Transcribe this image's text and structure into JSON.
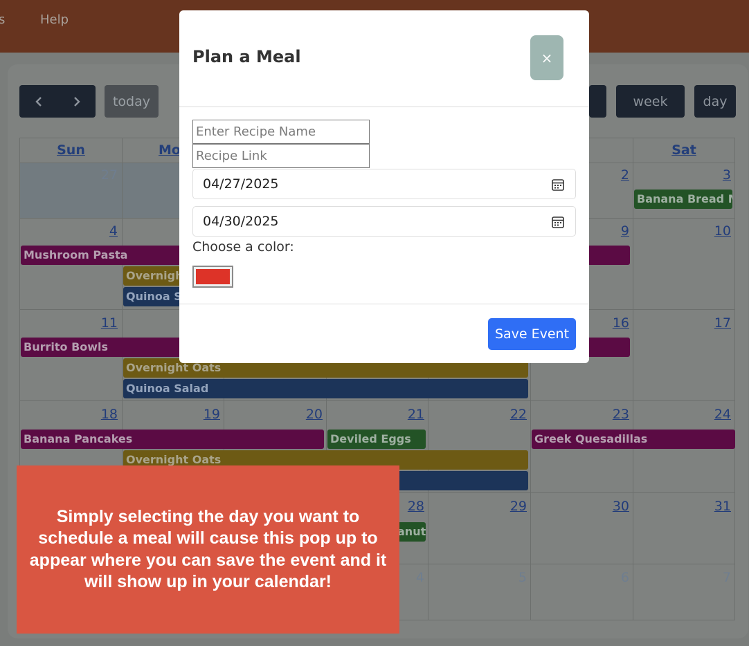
{
  "nav": {
    "left_fragment": "s",
    "help": "Help"
  },
  "toolbar": {
    "prev_icon": "chevron-left-icon",
    "next_icon": "chevron-right-icon",
    "today": "today",
    "week": "week",
    "day": "day"
  },
  "calendar": {
    "weekdays": [
      "Sun",
      "Mo",
      "Sat"
    ],
    "days": {
      "d27": "27",
      "d2": "2",
      "d3": "3",
      "d4": "4",
      "d9": "9",
      "d10": "10",
      "d11": "11",
      "d16": "16",
      "d17": "17",
      "d18": "18",
      "d19": "19",
      "d20": "20",
      "d21": "21",
      "d22": "22",
      "d23": "23",
      "d24": "24",
      "d28": "28",
      "d29": "29",
      "d30": "30",
      "d31": "31",
      "n4": "4",
      "n5": "5",
      "n6": "6",
      "n7": "7"
    },
    "events": {
      "banana_bread": "Banana Bread Muffins",
      "mushroom_pasta": "Mushroom Pasta",
      "overnight_oats": "Overnight",
      "quinoa_salad": "Quinoa Sa",
      "burrito_bowls": "Burrito Bowls",
      "overnight_oats_2": "Overnight Oats",
      "quinoa_salad_2": "Quinoa Salad",
      "banana_pancakes": "Banana Pancakes",
      "deviled_eggs": "Deviled Eggs",
      "greek_quesadillas": "Greek Quesadillas",
      "overnight_oats_3": "Overnight Oats",
      "peanut": "anut"
    }
  },
  "modal": {
    "title": "Plan a Meal",
    "close": "×",
    "recipe_name_placeholder": "Enter Recipe Name",
    "recipe_link_placeholder": "Recipe Link",
    "start_date": "04/27/2025",
    "end_date": "04/30/2025",
    "color_label": "Choose a color:",
    "color_value": "#dd3328",
    "save": "Save Event"
  },
  "note": {
    "text": "Simply selecting the day you want to schedule a meal will cause this pop up to appear where you can save the event and it will show up in your calendar!"
  }
}
